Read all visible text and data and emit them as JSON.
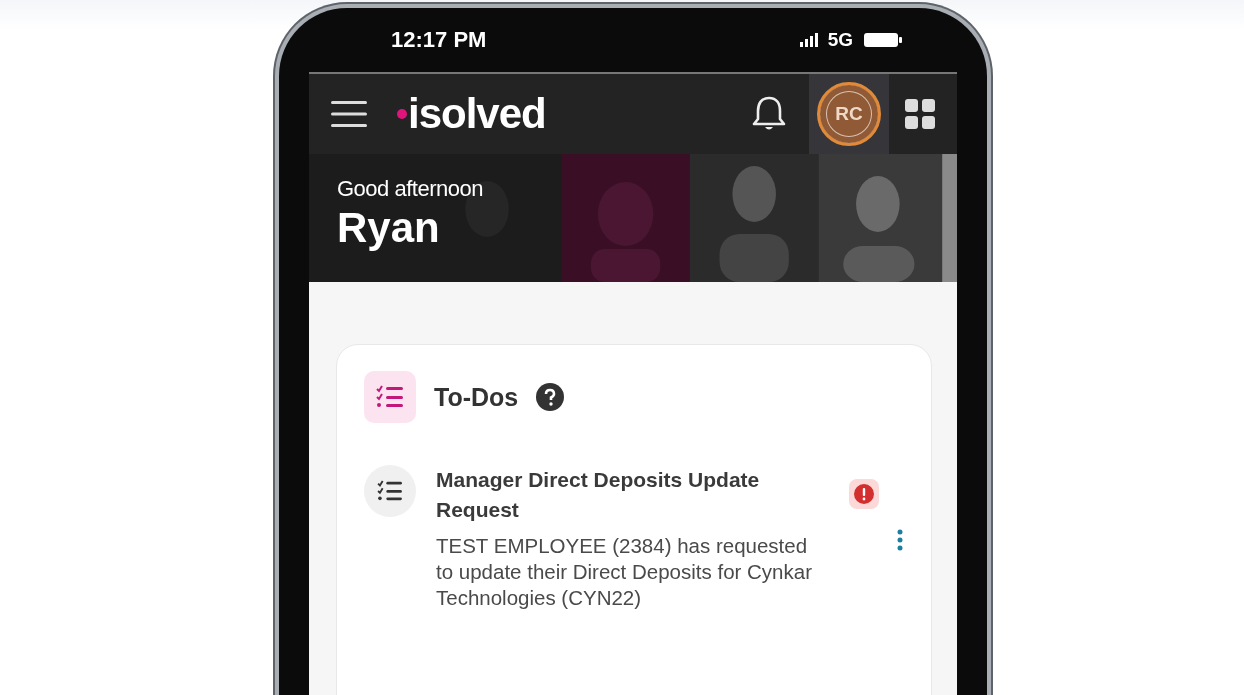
{
  "status_bar": {
    "time": "12:17 PM",
    "network": "5G"
  },
  "app_bar": {
    "logo": "isolved",
    "avatar_initials": "RC"
  },
  "banner": {
    "greeting": "Good afternoon",
    "name": "Ryan"
  },
  "todos": {
    "title": "To-Dos",
    "items": [
      {
        "title": "Manager Direct Deposits Update Request",
        "description": "TEST EMPLOYEE (2384) has requested to update their Direct Deposits for Cynkar Technologies (CYN22)",
        "urgent": true
      }
    ]
  }
}
